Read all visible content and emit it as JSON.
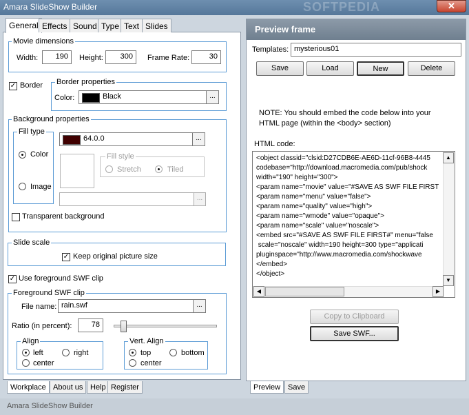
{
  "window": {
    "title": "Amara SlideShow Builder",
    "watermark": "SOFTPEDIA",
    "close_label": "✕"
  },
  "left_tabs": [
    "General",
    "Effects",
    "Sound",
    "Type",
    "Text",
    "Slides"
  ],
  "movie": {
    "legend": "Movie dimensions",
    "width_label": "Width:",
    "width": "190",
    "height_label": "Height:",
    "height": "300",
    "framerate_label": "Frame Rate:",
    "framerate": "30"
  },
  "border": {
    "checkbox_label": "Border",
    "legend": "Border properties",
    "color_label": "Color:",
    "color_value": "Black",
    "color_hex": "#000000",
    "dots": "..."
  },
  "background": {
    "legend": "Background properties",
    "fill_type_legend": "Fill type",
    "color_label": "Color",
    "image_label": "Image",
    "color_value": "64.0.0",
    "color_hex": "#400000",
    "fill_style_legend": "Fill style",
    "stretch_label": "Stretch",
    "tiled_label": "Tiled",
    "transparent_label": "Transparent background"
  },
  "slide_scale": {
    "legend": "Slide scale",
    "keep_label": "Keep original picture size"
  },
  "foreground": {
    "use_label": "Use foreground SWF clip",
    "legend": "Foreground SWF clip",
    "file_label": "File name:",
    "file_value": "rain.swf",
    "ratio_label": "Ratio (in percent):",
    "ratio_value": "78",
    "ratio_fraction": 0.78,
    "align_legend": "Align",
    "left_label": "left",
    "right_label": "right",
    "center_label": "center",
    "valign_legend": "Vert. Align",
    "top_label": "top",
    "bottom_label": "bottom",
    "vcenter_label": "center"
  },
  "left_bottom_tabs": [
    "Workplace",
    "About us",
    "Help",
    "Register"
  ],
  "preview": {
    "header": "Preview frame",
    "templates_label": "Templates:",
    "templates_value": "mysterious01",
    "buttons": {
      "save": "Save",
      "load": "Load",
      "new": "New",
      "delete": "Delete"
    },
    "note_line1": "NOTE: You should embed the code below into your",
    "note_line2": "HTML page (within the <body> section)",
    "code_label": "HTML code:",
    "code_lines": [
      "<object classid=\"clsid:D27CDB6E-AE6D-11cf-96B8-4445",
      "codebase=\"http://download.macromedia.com/pub/shock",
      "width=\"190\" height=\"300\">",
      "<param name=\"movie\" value=\"#SAVE AS SWF FILE FIRST",
      "<param name=\"menu\" value=\"false\">",
      "<param name=\"quality\" value=\"high\">",
      "<param name=\"wmode\" value=\"opaque\">",
      "<param name=\"scale\" value=\"noscale\">",
      "<embed src=\"#SAVE AS SWF FILE FIRST#\" menu=\"false",
      " scale=\"noscale\" width=190 height=300 type=\"applicati",
      "pluginspace=\"http://www.macromedia.com/shockwave",
      "</embed>",
      "</object>"
    ],
    "copy_button": "Copy to Clipboard",
    "save_swf_button": "Save SWF..."
  },
  "right_bottom_tabs": [
    "Preview",
    "Save"
  ],
  "status_text": "Amara SlideShow Builder"
}
